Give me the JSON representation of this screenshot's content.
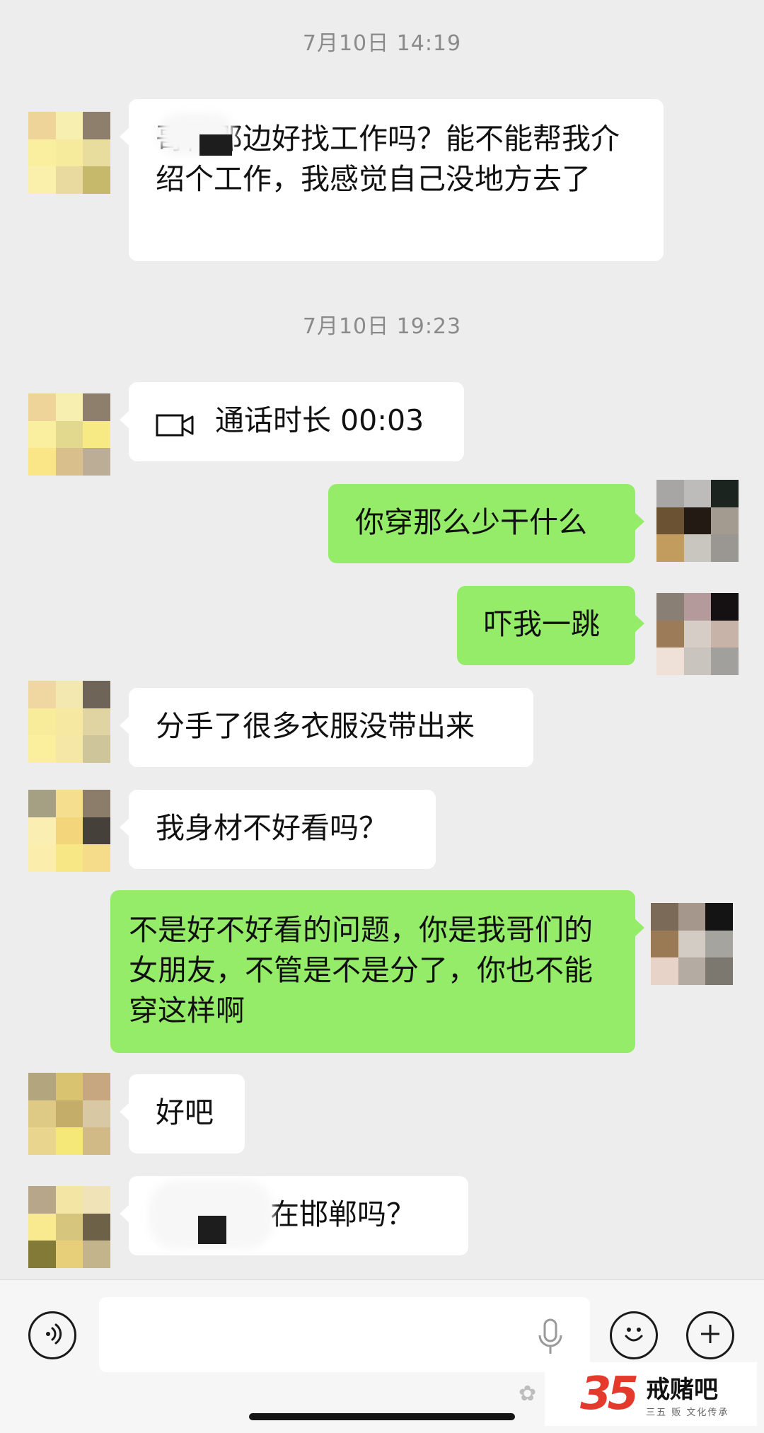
{
  "timestamps": [
    "7月10日 14:19",
    "7月10日 19:23"
  ],
  "messages": [
    {
      "side": "in",
      "text": "哥你那边好找工作吗？能不能帮我介绍个工作，我感觉自己没地方去了"
    },
    {
      "side": "in",
      "type": "call",
      "icon": "video-camera-icon",
      "text": "通话时长 00:03"
    },
    {
      "side": "out",
      "text": "你穿那么少干什么"
    },
    {
      "side": "out",
      "text": "吓我一跳"
    },
    {
      "side": "in",
      "text": "分手了很多衣服没带出来"
    },
    {
      "side": "in",
      "text": "我身材不好看吗？"
    },
    {
      "side": "out",
      "text": "不是好不好看的问题，你是我哥们的女朋友，不管是不是分了，你也不能穿这样啊"
    },
    {
      "side": "in",
      "text": "好吧"
    },
    {
      "side": "in",
      "text": "在邯郸吗？"
    }
  ],
  "input_bar": {
    "voice_icon": "voice-toggle-icon",
    "mic_icon": "microphone-icon",
    "emoji_icon": "emoji-icon",
    "plus_icon": "plus-icon",
    "placeholder": ""
  },
  "watermark": {
    "number": "35",
    "title": "戒赌吧",
    "subtitle": "三五 贩 文化传承"
  },
  "colors": {
    "background": "#ededed",
    "incoming_bubble": "#ffffff",
    "outgoing_bubble": "#95ec69",
    "timestamp": "#8a8a8a"
  }
}
